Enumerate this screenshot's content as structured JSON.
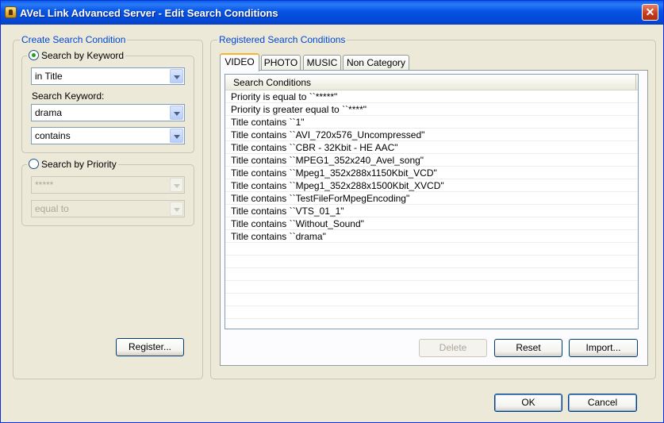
{
  "window": {
    "title": "AVeL Link Advanced Server - Edit Search Conditions",
    "close_glyph": "✕"
  },
  "create_group": {
    "legend": "Create Search Condition",
    "by_keyword": {
      "label": "Search by Keyword",
      "checked": true,
      "field_value": "in Title",
      "keyword_label": "Search Keyword:",
      "keyword_value": "drama",
      "operator_value": "contains"
    },
    "by_priority": {
      "label": "Search by Priority",
      "checked": false,
      "value": "*****",
      "operator_value": "equal to"
    },
    "register_label": "Register..."
  },
  "registered_group": {
    "legend": "Registered Search Conditions",
    "tabs": [
      {
        "label": "VIDEO",
        "active": true
      },
      {
        "label": "PHOTO",
        "active": false
      },
      {
        "label": "MUSIC",
        "active": false
      },
      {
        "label": "Non Category",
        "active": false
      }
    ],
    "list_header": "Search Conditions",
    "rows": [
      "Priority is equal to ``*****\"",
      "Priority is greater equal to ``****\"",
      "Title contains ``1\"",
      "Title contains ``AVI_720x576_Uncompressed\"",
      "Title contains ``CBR - 32Kbit - HE AAC\"",
      "Title contains ``MPEG1_352x240_Avel_song\"",
      "Title contains ``Mpeg1_352x288x1150Kbit_VCD\"",
      "Title contains ``Mpeg1_352x288x1500Kbit_XVCD\"",
      "Title contains ``TestFileForMpegEncoding\"",
      "Title contains ``VTS_01_1\"",
      "Title contains ``Without_Sound\"",
      "Title contains ``drama\""
    ],
    "delete_label": "Delete",
    "reset_label": "Reset",
    "import_label": "Import..."
  },
  "footer": {
    "ok_label": "OK",
    "cancel_label": "Cancel"
  },
  "colors": {
    "title_bar": "#0554e3",
    "group_legend": "#0046d5",
    "window_bg": "#ece9d8"
  }
}
